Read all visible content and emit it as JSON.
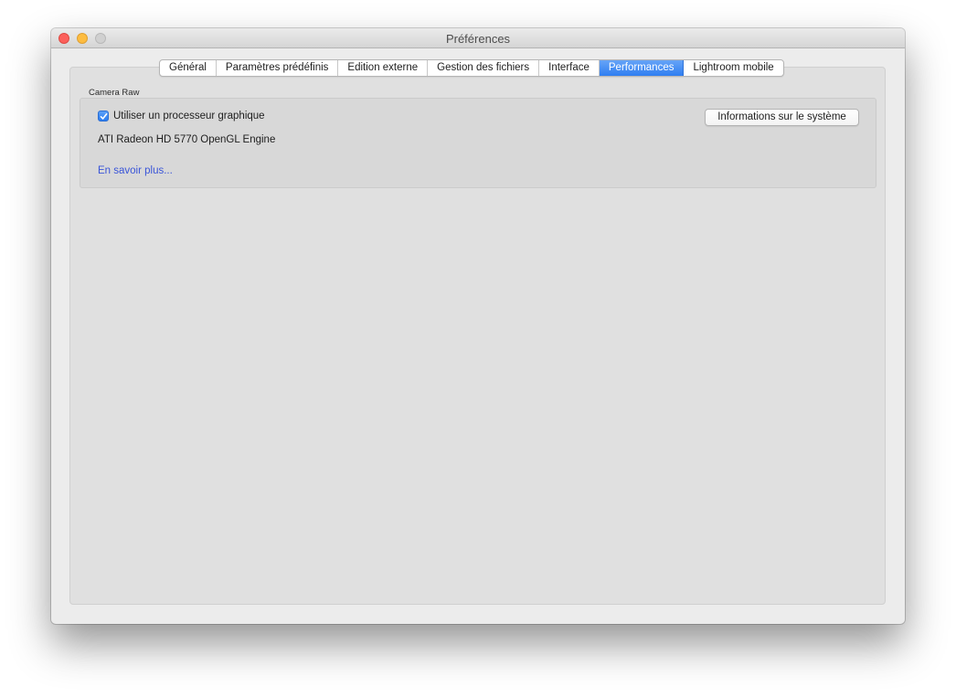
{
  "window": {
    "title": "Préférences"
  },
  "tabs": [
    {
      "label": "Général",
      "active": false
    },
    {
      "label": "Paramètres prédéfinis",
      "active": false
    },
    {
      "label": "Edition externe",
      "active": false
    },
    {
      "label": "Gestion des fichiers",
      "active": false
    },
    {
      "label": "Interface",
      "active": false
    },
    {
      "label": "Performances",
      "active": true
    },
    {
      "label": "Lightroom mobile",
      "active": false
    }
  ],
  "camera_raw": {
    "group_label": "Camera Raw",
    "use_gpu_label": "Utiliser un processeur graphique",
    "use_gpu_checked": true,
    "gpu_name": "ATI Radeon HD 5770 OpenGL Engine",
    "learn_more_link": "En savoir plus...",
    "system_info_button": "Informations sur le système"
  },
  "colors": {
    "accent": "#2f7ef1",
    "link": "#3a55d8",
    "close": "#fc605b",
    "minimize": "#fdbc40",
    "zoom_disabled": "#d0d0d0"
  }
}
